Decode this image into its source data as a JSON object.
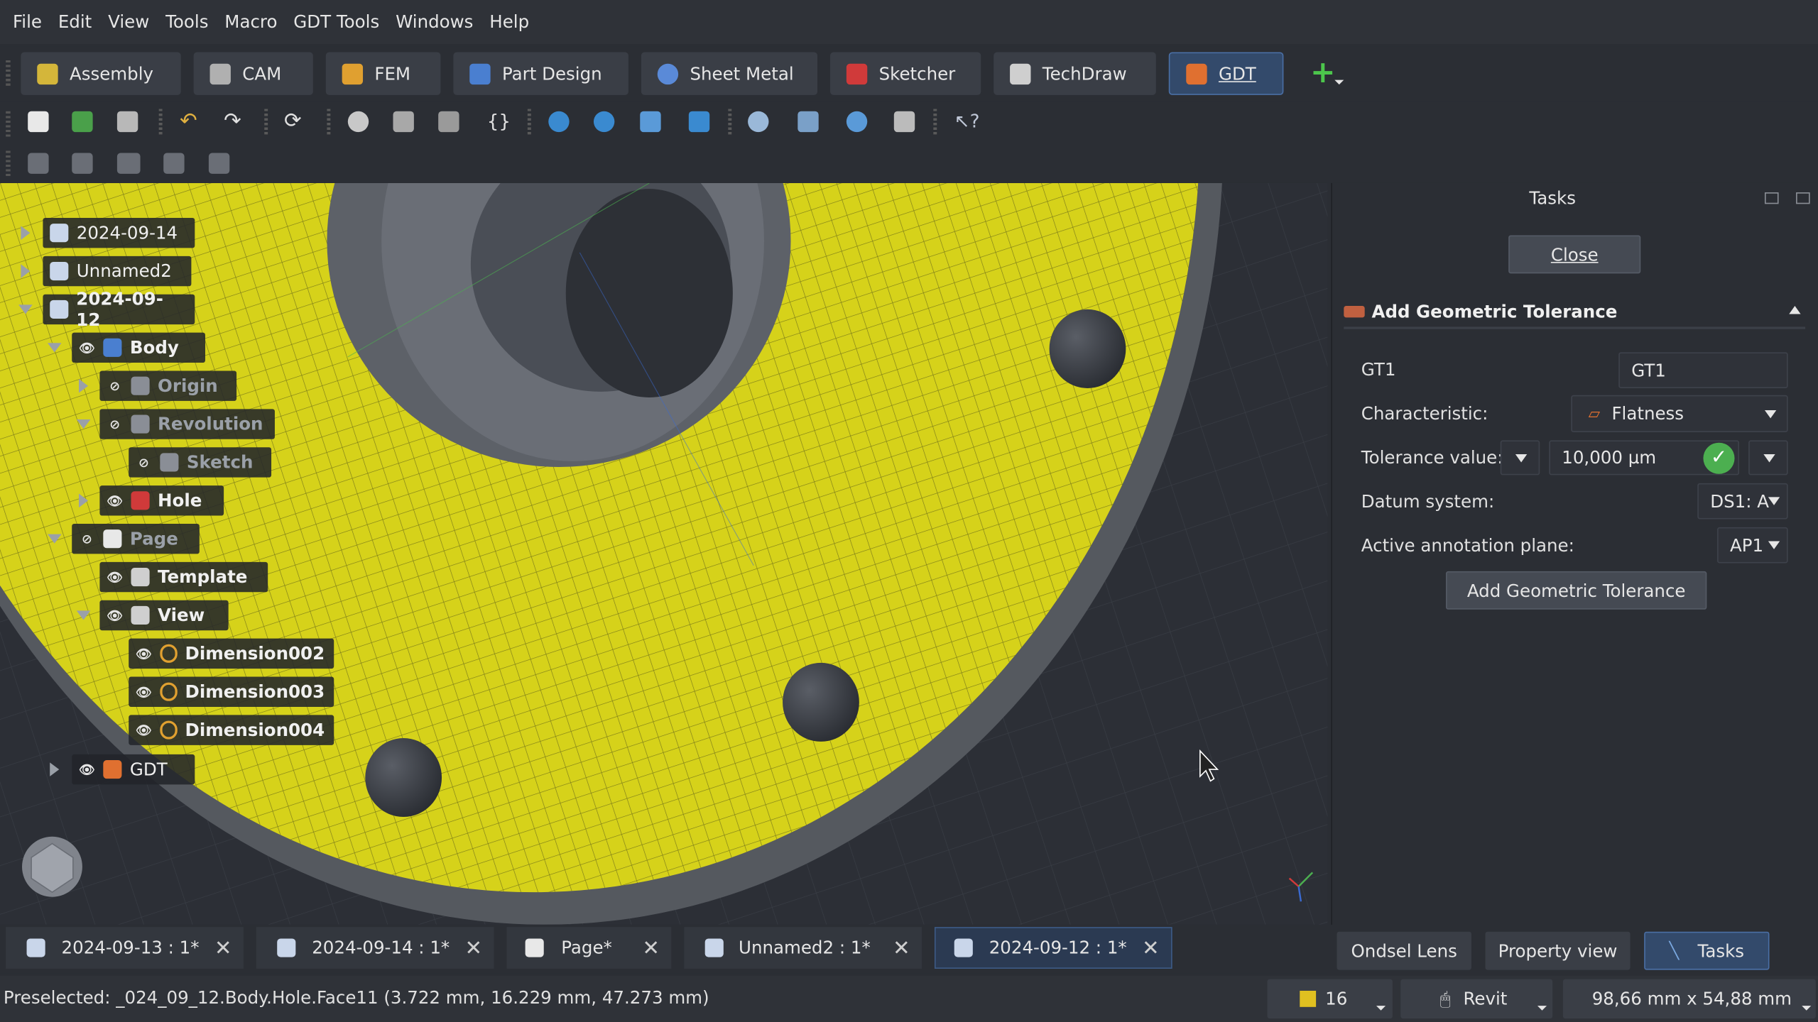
{
  "menu": [
    "File",
    "Edit",
    "View",
    "Tools",
    "Macro",
    "GDT Tools",
    "Windows",
    "Help"
  ],
  "workbenches": [
    {
      "label": "Assembly",
      "color": "#d4b63a"
    },
    {
      "label": "CAM",
      "color": "#b0b0b0"
    },
    {
      "label": "FEM",
      "color": "#e0a030"
    },
    {
      "label": "Part Design",
      "color": "#4a7fd0"
    },
    {
      "label": "Sheet Metal",
      "color": "#5a8ad8"
    },
    {
      "label": "Sketcher",
      "color": "#d03a3a"
    },
    {
      "label": "TechDraw",
      "color": "#cfcfcf"
    },
    {
      "label": "GDT",
      "color": "#e07030"
    }
  ],
  "tree": {
    "docs": [
      "2024-09-14",
      "Unnamed2",
      "2024-09-12"
    ],
    "items": [
      "Body",
      "Origin",
      "Revolution",
      "Sketch",
      "Hole",
      "Page",
      "Template",
      "View",
      "Dimension002",
      "Dimension003",
      "Dimension004",
      "GDT"
    ]
  },
  "tasks": {
    "title": "Tasks",
    "close": "Close",
    "section": "Add Geometric Tolerance",
    "name_label": "GT1",
    "name_value": "GT1",
    "characteristic_label": "Characteristic:",
    "characteristic_value": "Flatness",
    "tolerance_label": "Tolerance value:",
    "tolerance_value": "10,000 µm",
    "datum_label": "Datum system:",
    "datum_value": "DS1: A",
    "plane_label": "Active annotation plane:",
    "plane_value": "AP1",
    "add_button": "Add Geometric Tolerance"
  },
  "doc_tabs": [
    "2024-09-13 : 1*",
    "2024-09-14 : 1*",
    "Page*",
    "Unnamed2 : 1*",
    "2024-09-12 : 1*"
  ],
  "panel_tabs": [
    "Ondsel Lens",
    "Property view",
    "Tasks"
  ],
  "status": {
    "message": "Preselected: _024_09_12.Body.Hole.Face11 (3.722 mm, 16.229 mm, 47.273 mm)",
    "count": "16",
    "nav": "Revit",
    "size": "98,66 mm x 54,88 mm"
  }
}
